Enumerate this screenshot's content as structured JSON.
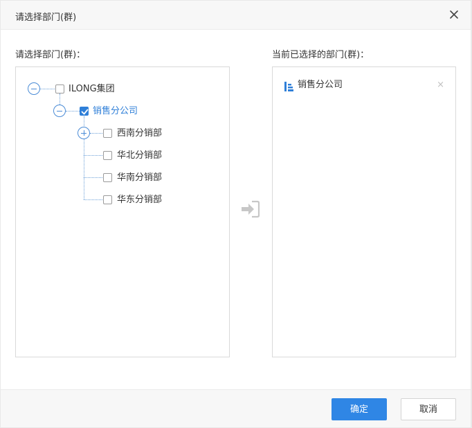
{
  "dialog": {
    "title": "请选择部门(群)",
    "left_label": "请选择部门(群)：",
    "right_label": "当前已选择的部门(群)：",
    "close_icon": "close-icon",
    "transfer_icon": "arrow-into-icon"
  },
  "tree": {
    "root": {
      "label": "ILONG集团",
      "expanded": true,
      "checked": false
    },
    "child": {
      "label": "销售分公司",
      "expanded": true,
      "checked": true
    },
    "leaves": [
      {
        "label": "西南分销部",
        "has_children": true,
        "checked": false
      },
      {
        "label": "华北分销部",
        "has_children": false,
        "checked": false
      },
      {
        "label": "华南分销部",
        "has_children": false,
        "checked": false
      },
      {
        "label": "华东分销部",
        "has_children": false,
        "checked": false
      }
    ]
  },
  "selected": [
    {
      "label": "销售分公司",
      "icon": "org-structure-icon",
      "remove": "×"
    }
  ],
  "footer": {
    "confirm_label": "确定",
    "cancel_label": "取消"
  },
  "colors": {
    "accent": "#2f86e5",
    "tree_line": "#6a9fd8"
  }
}
